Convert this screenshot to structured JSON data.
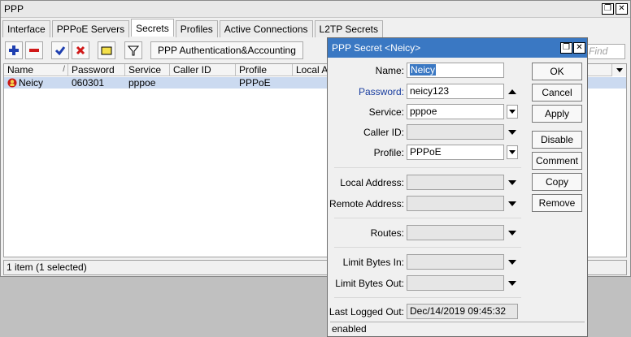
{
  "window": {
    "title": "PPP"
  },
  "tabs": [
    {
      "label": "Interface"
    },
    {
      "label": "PPPoE Servers"
    },
    {
      "label": "Secrets"
    },
    {
      "label": "Profiles"
    },
    {
      "label": "Active Connections"
    },
    {
      "label": "L2TP Secrets"
    }
  ],
  "toolbar": {
    "auth_button": "PPP Authentication&Accounting",
    "find_placeholder": "Find"
  },
  "table": {
    "columns": [
      "Name",
      "Password",
      "Service",
      "Caller ID",
      "Profile",
      "Local Ad"
    ],
    "rows": [
      {
        "name": "Neicy",
        "password": "060301",
        "service": "pppoe",
        "caller_id": "",
        "profile": "PPPoE"
      }
    ]
  },
  "status": {
    "text": "1 item (1 selected)"
  },
  "dialog": {
    "title": "PPP Secret <Neicy>",
    "fields": {
      "name": {
        "label": "Name:",
        "value": "Neicy"
      },
      "password": {
        "label": "Password:",
        "value": "neicy123"
      },
      "service": {
        "label": "Service:",
        "value": "pppoe"
      },
      "caller_id": {
        "label": "Caller ID:",
        "value": ""
      },
      "profile": {
        "label": "Profile:",
        "value": "PPPoE"
      },
      "local_address": {
        "label": "Local Address:",
        "value": ""
      },
      "remote_address": {
        "label": "Remote Address:",
        "value": ""
      },
      "routes": {
        "label": "Routes:",
        "value": ""
      },
      "limit_in": {
        "label": "Limit Bytes In:",
        "value": ""
      },
      "limit_out": {
        "label": "Limit Bytes Out:",
        "value": ""
      },
      "last_logged_out": {
        "label": "Last Logged Out:",
        "value": "Dec/14/2019 09:45:32"
      }
    },
    "buttons": {
      "ok": "OK",
      "cancel": "Cancel",
      "apply": "Apply",
      "disable": "Disable",
      "comment": "Comment",
      "copy": "Copy",
      "remove": "Remove"
    },
    "status": "enabled"
  },
  "colors": {
    "accent": "#3a78c3",
    "selected_row": "#cbdaf0",
    "label_blue": "#1a3ea0"
  }
}
